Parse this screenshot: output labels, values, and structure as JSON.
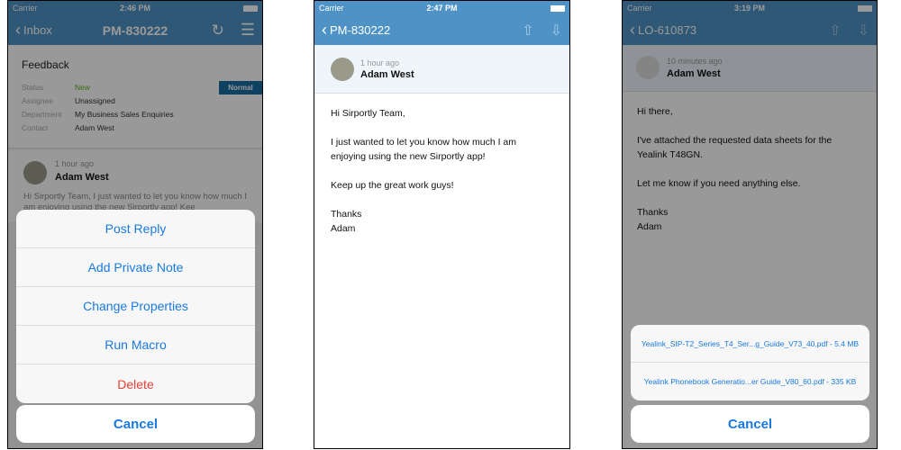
{
  "colors": {
    "nav": "#4f93c6",
    "nav_dim": "#2f5a7a",
    "accent": "#1a7ae0",
    "delete": "#e8413a",
    "status_new": "#5fb31a",
    "badge": "#1a6fa0"
  },
  "phone1": {
    "status": {
      "carrier": "Carrier",
      "time": "2:46 PM"
    },
    "nav": {
      "back": "Inbox",
      "title": "PM-830222",
      "icons": [
        "refresh-icon",
        "menu-icon"
      ]
    },
    "ticket": {
      "subject": "Feedback",
      "priority": "Normal",
      "fields": [
        {
          "label": "Status",
          "value": "New"
        },
        {
          "label": "Assignee",
          "value": "Unassigned"
        },
        {
          "label": "Department",
          "value": "My Business Sales Enquiries"
        },
        {
          "label": "Contact",
          "value": "Adam West"
        }
      ]
    },
    "message": {
      "time": "1 hour ago",
      "author": "Adam West",
      "preview": "Hi Sirportly Team, I just wanted to let you know how much I am enjoying using the new Sirportly app! Kee"
    },
    "actions": [
      "Post Reply",
      "Add Private Note",
      "Change Properties",
      "Run Macro",
      "Delete"
    ],
    "cancel": "Cancel"
  },
  "phone2": {
    "status": {
      "carrier": "Carrier",
      "time": "2:47 PM"
    },
    "nav": {
      "back": "PM-830222",
      "icons": [
        "arrow-up-icon",
        "arrow-down-icon"
      ]
    },
    "message": {
      "time": "1 hour ago",
      "author": "Adam West",
      "paragraphs": [
        "Hi Sirportly Team,",
        "I just wanted to let you know how much I am enjoying using the new Sirportly app!",
        "Keep up the great work guys!",
        "Thanks\nAdam"
      ]
    }
  },
  "phone3": {
    "status": {
      "carrier": "Carrier",
      "time": "3:19 PM"
    },
    "nav": {
      "back": "LO-610873",
      "icons": [
        "arrow-up-icon",
        "arrow-down-icon"
      ]
    },
    "message": {
      "time": "10 minutes ago",
      "author": "Adam West",
      "paragraphs": [
        "Hi there,",
        "I've attached the requested data sheets for the Yealink T48GN.",
        "Let me know if you need anything else.",
        "Thanks\nAdam"
      ]
    },
    "attachments": [
      "Yealink_SIP-T2_Series_T4_Ser...g_Guide_V73_40.pdf - 5.4 MB",
      "Yealink Phonebook Generatio...er Guide_V80_60.pdf - 335 KB"
    ],
    "cancel": "Cancel"
  }
}
